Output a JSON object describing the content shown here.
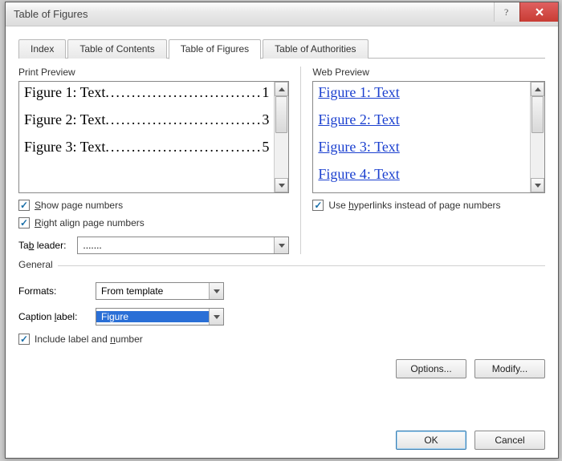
{
  "window": {
    "title": "Table of Figures"
  },
  "tabs": {
    "index": "Index",
    "toc": "Table of Contents",
    "tof": "Table of Figures",
    "toa": "Table of Authorities"
  },
  "print_preview": {
    "label": "Print Preview",
    "rows": [
      {
        "label": "Figure 1: Text",
        "page": "1"
      },
      {
        "label": "Figure 2: Text",
        "page": "3"
      },
      {
        "label": "Figure 3: Text",
        "page": "5"
      }
    ],
    "show_page_numbers_prefix": "S",
    "show_page_numbers": "how page numbers",
    "right_align_prefix": "R",
    "right_align": "ight align page numbers",
    "tab_leader_label_prefix": "Ta",
    "tab_leader_label_u": "b",
    "tab_leader_label_suffix": " leader:",
    "tab_leader_value": "......."
  },
  "web_preview": {
    "label": "Web Preview",
    "links": [
      "Figure 1: Text",
      "Figure 2: Text",
      "Figure 3: Text",
      "Figure 4: Text"
    ],
    "use_hyperlinks_prefix": "Use ",
    "use_hyperlinks_u": "h",
    "use_hyperlinks_suffix": "yperlinks instead of page numbers"
  },
  "general": {
    "legend": "General",
    "formats_label": "Formats:",
    "formats_value": "From template",
    "caption_label_prefix": "Caption ",
    "caption_label_u": "l",
    "caption_label_suffix": "abel:",
    "caption_value": "Figure",
    "include_label_prefix": "Include label and ",
    "include_label_u": "n",
    "include_label_suffix": "umber"
  },
  "buttons": {
    "options": "Options...",
    "modify": "Modify...",
    "ok": "OK",
    "cancel": "Cancel"
  }
}
